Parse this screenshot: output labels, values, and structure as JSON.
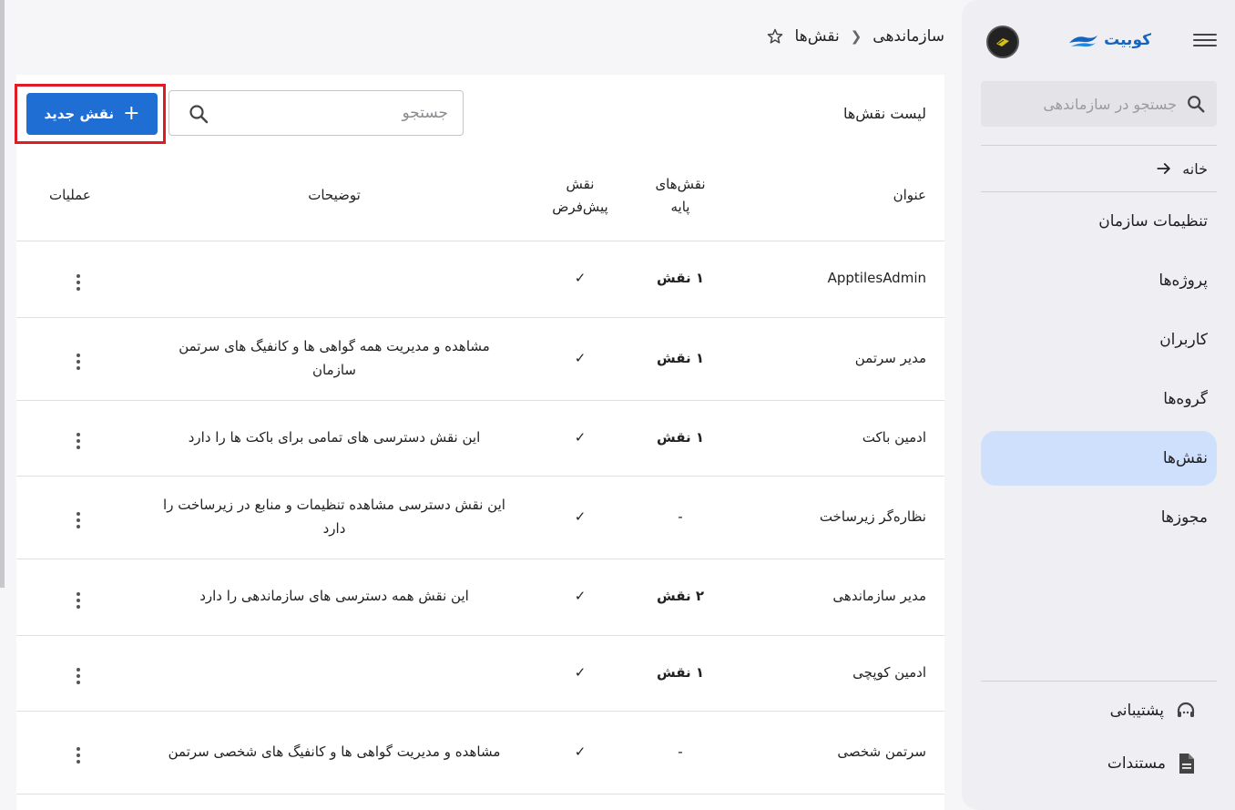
{
  "sidebar": {
    "brand": "کوبیت",
    "search_placeholder": "جستجو در سازماندهی",
    "home_label": "خانه",
    "items": [
      {
        "label": "تنظیمات سازمان",
        "active": false
      },
      {
        "label": "پروژه‌ها",
        "active": false
      },
      {
        "label": "کاربران",
        "active": false
      },
      {
        "label": "گروه‌ها",
        "active": false
      },
      {
        "label": "نقش‌ها",
        "active": true
      },
      {
        "label": "مجوزها",
        "active": false
      }
    ],
    "bottom": {
      "support": "پشتیبانی",
      "docs": "مستندات"
    }
  },
  "breadcrumb": {
    "parent": "سازماندهی",
    "current": "نقش‌ها"
  },
  "toolbar": {
    "list_title": "لیست نقش‌ها",
    "search_placeholder": "جستجو",
    "new_role_label": "نقش جدید"
  },
  "table": {
    "headers": {
      "title": "عنوان",
      "base_roles_line1": "نقش‌های",
      "base_roles_line2": "پایه",
      "default_line1": "نقش",
      "default_line2": "پیش‌فرض",
      "description": "توضیحات",
      "operations": "عملیات"
    },
    "rows": [
      {
        "title": "ApptilesAdmin",
        "base": "۱ نقش",
        "default": "✓",
        "desc": ""
      },
      {
        "title": "مدیر سرتمن",
        "base": "۱ نقش",
        "default": "✓",
        "desc": "مشاهده و مدیریت همه گواهی ها و کانفیگ های سرتمن سازمان"
      },
      {
        "title": "ادمین باکت",
        "base": "۱ نقش",
        "default": "✓",
        "desc": "این نقش دسترسی های تمامی برای باکت ها را دارد"
      },
      {
        "title": "نظاره‌گر زیرساخت",
        "base": "-",
        "default": "✓",
        "desc": "این نقش دسترسی مشاهده تنظیمات و منابع در زیرساخت را دارد"
      },
      {
        "title": "مدیر سازماندهی",
        "base": "۲ نقش",
        "default": "✓",
        "desc": "این نقش همه دسترسی های سازماندهی را دارد"
      },
      {
        "title": "ادمین کوپچی",
        "base": "۱ نقش",
        "default": "✓",
        "desc": ""
      },
      {
        "title": "سرتمن شخصی",
        "base": "-",
        "default": "✓",
        "desc": "مشاهده و مدیریت گواهی ها و کانفیگ های شخصی سرتمن"
      }
    ]
  },
  "colors": {
    "accent": "#1f6ed4",
    "active_nav": "#cfe0fd",
    "highlight_box": "#e01b24"
  }
}
